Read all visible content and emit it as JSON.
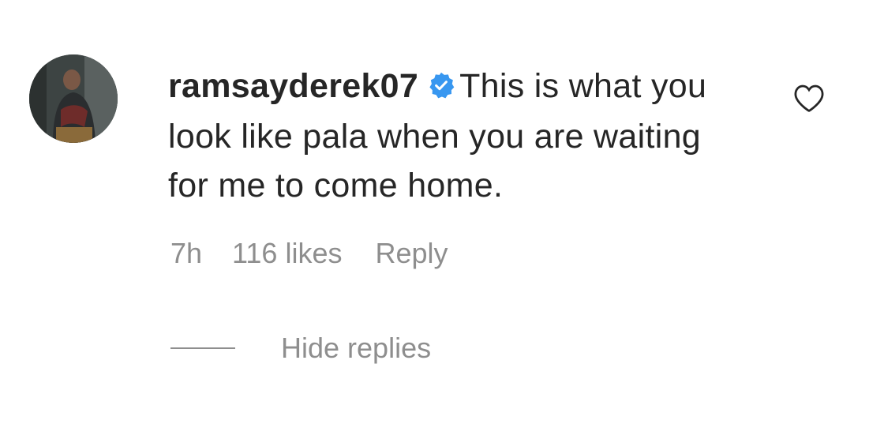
{
  "comment": {
    "username": "ramsayderek07",
    "verified_icon": "verified-badge-icon",
    "verified_color": "#3897f0",
    "text": "This is what you look like pala when you are waiting for me to come home.",
    "time": "7h",
    "likes": "116 likes",
    "reply_label": "Reply",
    "like_icon": "heart-icon"
  },
  "replies": {
    "toggle_label": "Hide replies"
  }
}
